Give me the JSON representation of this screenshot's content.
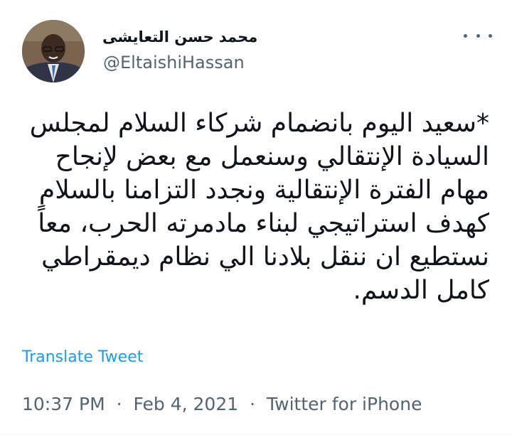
{
  "author": {
    "display_name": "محمد حسن التعايشى",
    "handle": "@EltaishiHassan"
  },
  "tweet": {
    "lines": [
      "*سعيد اليوم بانضمام شركاء السلام لمجلس",
      "السيادة الإنتقالي وسنعمل مع بعض لإنجاح",
      "مهام الفترة الإنتقالية ونجدد التزامنا بالسلام",
      "كهدف استراتيجي لبناء مادمرته الحرب، معاً",
      "نستطيع ان ننقل بلادنا الي نظام ديمقراطي",
      "كامل الدسم."
    ],
    "translate_label": "Translate Tweet",
    "time": "10:37 PM",
    "date": "Feb 4, 2021",
    "separator": "·",
    "source": "Twitter for iPhone"
  },
  "icons": {
    "more": "more-horizontal-icon"
  },
  "colors": {
    "link": "#1d9bf0",
    "secondary_text": "#536471",
    "primary_text": "#0f1419"
  }
}
